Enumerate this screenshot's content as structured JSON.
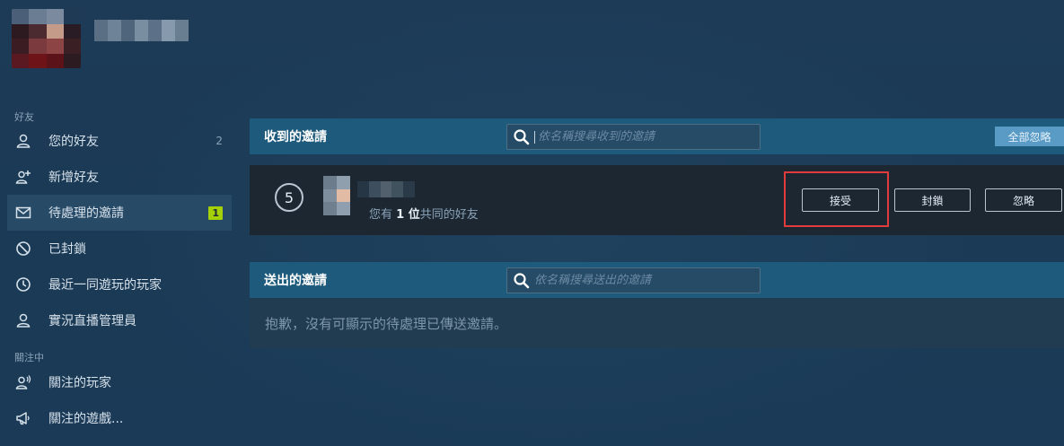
{
  "colors": {
    "accent": "#1d5a7c",
    "active_item": "#274a67",
    "badge_green": "#a4d007",
    "highlight_red": "#e23b3b",
    "ignore_all_button": "#5a9bc6"
  },
  "sidebar": {
    "section_friends": "好友",
    "section_following": "關注中",
    "items": [
      {
        "label": "您的好友",
        "icon": "person-icon",
        "count": "2"
      },
      {
        "label": "新增好友",
        "icon": "add-friend-icon"
      },
      {
        "label": "待處理的邀請",
        "icon": "envelope-icon",
        "badge": "1",
        "active": true
      },
      {
        "label": "已封鎖",
        "icon": "block-icon"
      },
      {
        "label": "最近一同遊玩的玩家",
        "icon": "clock-icon"
      },
      {
        "label": "實況直播管理員",
        "icon": "person-icon"
      },
      {
        "label": "關注的玩家",
        "icon": "broadcast-person-icon"
      },
      {
        "label": "關注的遊戲...",
        "icon": "megaphone-icon"
      }
    ]
  },
  "received": {
    "title": "收到的邀請",
    "search_placeholder": "依名稱搜尋收到的邀請",
    "ignore_all": "全部忽略",
    "invite": {
      "level": "5",
      "mutual_prefix": "您有",
      "mutual_count": "1 位",
      "mutual_suffix": "共同的好友",
      "accept": "接受",
      "block": "封鎖",
      "ignore": "忽略"
    }
  },
  "sent": {
    "title": "送出的邀請",
    "search_placeholder": "依名稱搜尋送出的邀請",
    "empty_message": "抱歉，沒有可顯示的待處理已傳送邀請。"
  }
}
